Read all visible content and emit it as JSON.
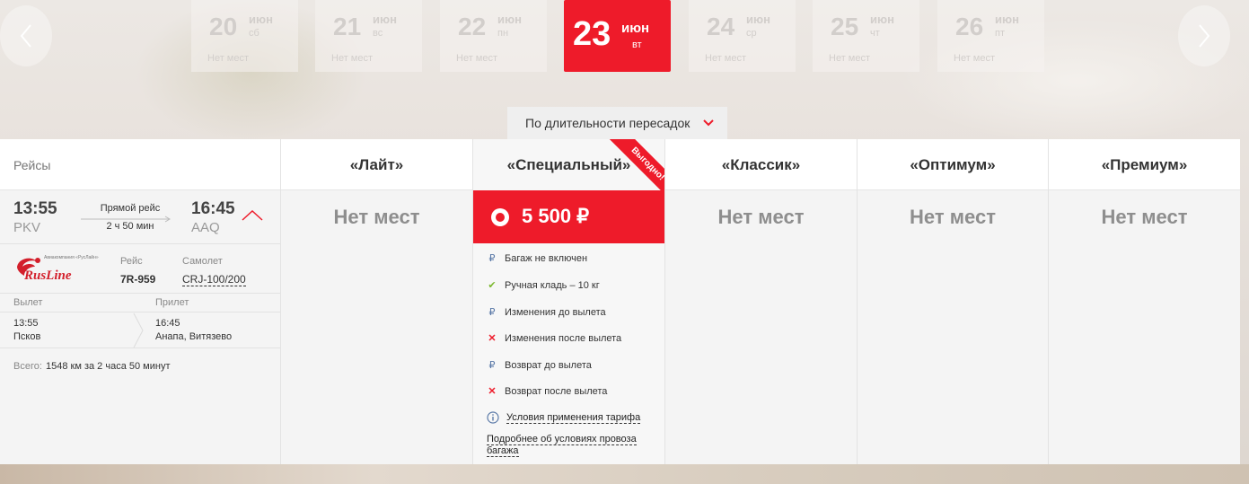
{
  "dates": [
    {
      "day": "20",
      "month": "июн",
      "weekday": "сб",
      "status": "Нет мест"
    },
    {
      "day": "21",
      "month": "июн",
      "weekday": "вс",
      "status": "Нет мест"
    },
    {
      "day": "22",
      "month": "июн",
      "weekday": "пн",
      "status": "Нет мест"
    },
    {
      "day": "23",
      "month": "июн",
      "weekday": "вт",
      "status": ""
    },
    {
      "day": "24",
      "month": "июн",
      "weekday": "ср",
      "status": "Нет мест"
    },
    {
      "day": "25",
      "month": "июн",
      "weekday": "чт",
      "status": "Нет мест"
    },
    {
      "day": "26",
      "month": "июн",
      "weekday": "пт",
      "status": "Нет мест"
    }
  ],
  "sort": {
    "label": "По длительности пересадок"
  },
  "table": {
    "flights_header": "Рейсы",
    "fares": [
      {
        "name": "«Лайт»",
        "status": "Нет мест"
      },
      {
        "name": "«Специальный»",
        "badge": "Выгодно!",
        "price": "5 500 ₽"
      },
      {
        "name": "«Классик»",
        "status": "Нет мест"
      },
      {
        "name": "«Оптимум»",
        "status": "Нет мест"
      },
      {
        "name": "«Премиум»",
        "status": "Нет мест"
      }
    ]
  },
  "flight": {
    "dep_time": "13:55",
    "dep_code": "PKV",
    "arr_time": "16:45",
    "arr_code": "AAQ",
    "type": "Прямой рейс",
    "duration": "2 ч 50 мин",
    "airline_logo": "RusLine",
    "airline_tagline": "Авиакомпания «РусЛайн»",
    "flight_label": "Рейс",
    "flight_number": "7R-959",
    "aircraft_label": "Самолет",
    "aircraft": "CRJ-100/200",
    "departure_label": "Вылет",
    "arrival_label": "Прилет",
    "dep_detail_time": "13:55",
    "dep_city": "Псков",
    "arr_detail_time": "16:45",
    "arr_city": "Анапа, Витязево",
    "total_label": "Всего:",
    "total_value": "1548 км за 2 часа 50 минут"
  },
  "features": [
    {
      "icon": "ruble-icon",
      "text": "Багаж не включен"
    },
    {
      "icon": "check-icon",
      "text": "Ручная кладь – 10 кг"
    },
    {
      "icon": "ruble-icon",
      "text": "Изменения до вылета"
    },
    {
      "icon": "cross-icon",
      "text": "Изменения после вылета"
    },
    {
      "icon": "ruble-icon",
      "text": "Возврат до вылета"
    },
    {
      "icon": "cross-icon",
      "text": "Возврат после вылета"
    }
  ],
  "links": {
    "conditions": "Условия применения тарифа",
    "baggage_line1": "Подробнее об условиях провоза",
    "baggage_line2": "багажа"
  },
  "colors": {
    "accent": "#ee1b2a"
  }
}
